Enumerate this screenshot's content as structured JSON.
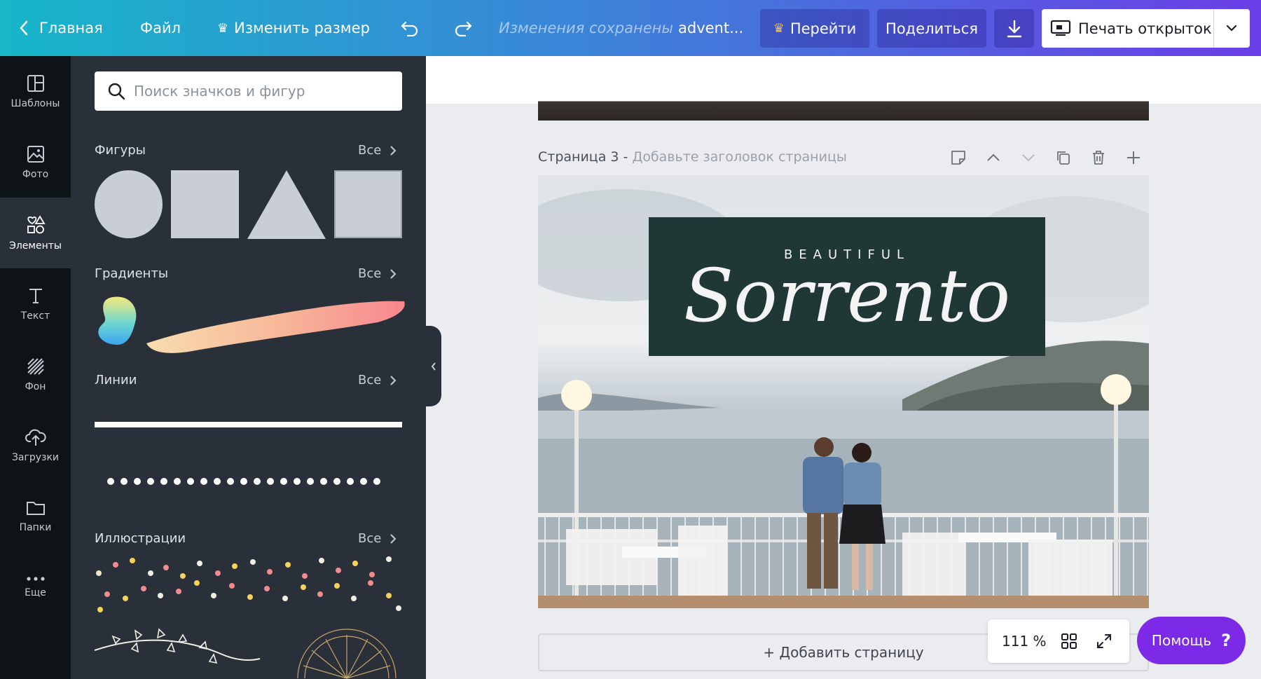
{
  "topbar": {
    "home": "Главная",
    "file": "Файл",
    "resize": "Изменить размер",
    "status": "Изменения сохранены",
    "doc_title": "advent...",
    "upgrade": "Перейти",
    "share": "Поделиться",
    "print": "Печать открыток"
  },
  "rail": {
    "templates": "Шаблоны",
    "photos": "Фото",
    "elements": "Элементы",
    "text": "Текст",
    "background": "Фон",
    "uploads": "Загрузки",
    "folders": "Папки",
    "more": "Еще"
  },
  "panel": {
    "search_placeholder": "Поиск значков и фигур",
    "shapes_title": "Фигуры",
    "gradients_title": "Градиенты",
    "lines_title": "Линии",
    "illustrations_title": "Иллюстрации",
    "see_all": "Все"
  },
  "canvas": {
    "page_label": "Страница 3 -",
    "page_hint": "Добавьте заголовок страницы",
    "banner_small": "BEAUTIFUL",
    "banner_large": "Sorrento",
    "add_page": "+ Добавить страницу"
  },
  "zoom": {
    "level": "111 %"
  },
  "help": {
    "label": "Помощь",
    "mark": "?"
  },
  "colors": {
    "accent": "#7d2ae8",
    "banner": "#1f3835",
    "panel_bg": "#293039",
    "rail_bg": "#0e1318"
  }
}
